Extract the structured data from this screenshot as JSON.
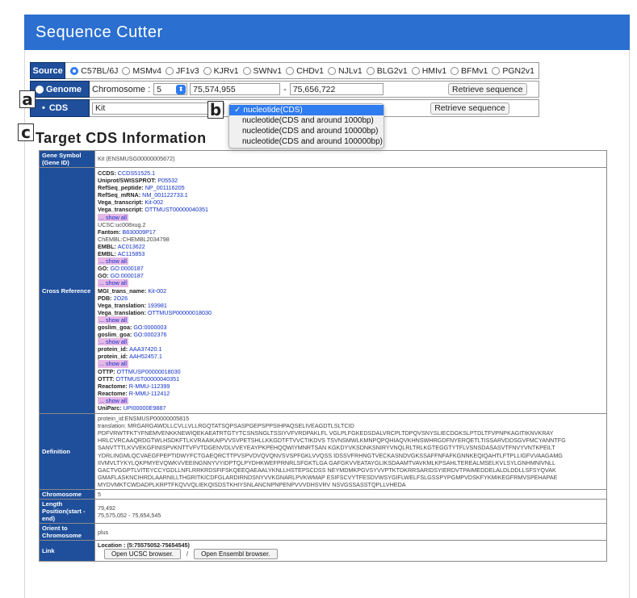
{
  "app": {
    "title": "Sequence Cutter"
  },
  "source": {
    "label": "Source",
    "options": [
      "C57BL/6J",
      "MSMv4",
      "JF1v3",
      "KJRv1",
      "SWNv1",
      "CHDv1",
      "NJLv1",
      "BLG2v1",
      "HMIv1",
      "BFMv1",
      "PGN2v1"
    ],
    "selected": "C57BL/6J"
  },
  "genome": {
    "label": "Genome",
    "chromosome_label": "Chromosome :",
    "chromosome_value": "5",
    "start": "75,574,955",
    "separator": "-",
    "end": "75,656,722",
    "retrieve_label": "Retrieve sequence"
  },
  "cds": {
    "label": "CDS",
    "gene_value": "Kit",
    "retrieve_label": "Retrieve sequence",
    "dropdown_options": [
      "nucleotide(CDS)",
      "nucleotide(CDS and around 1000bp)",
      "nucleotide(CDS and around 10000bp)",
      "nucleotide(CDS and around 100000bp)"
    ],
    "selected_check": "✓"
  },
  "annotations": {
    "a": "a",
    "b": "b",
    "c": "c"
  },
  "section_title": "Target CDS Information",
  "info": {
    "gene_symbol_header": "Gene Symbol (Gene ID)",
    "gene_symbol_value": "Kit (ENSMUSG00000005672)",
    "cross_header": "Cross Reference",
    "cross_ref": [
      {
        "k": "CCDS:",
        "v": "CCDS51525.1"
      },
      {
        "k": "Uniprot/SWISSPROT:",
        "v": "P05532"
      },
      {
        "k": "RefSeq_peptide:",
        "v": "NP_001116205"
      },
      {
        "k": "RefSeq_mRNA:",
        "v": "NM_001122733.1"
      },
      {
        "k": "Vega_transcript:",
        "v": "Kit-002"
      },
      {
        "k": "Vega_transcript:",
        "v": "OTTMUST00000040351"
      },
      {
        "show": "... show all"
      },
      {
        "plain": "UCSC:uc008xug.2"
      },
      {
        "k": "Fantom:",
        "v": "B830009P17"
      },
      {
        "plain": "ChEMBL:CHEMBL2034798"
      },
      {
        "k": "EMBL:",
        "v": "AC013622"
      },
      {
        "k": "EMBL:",
        "v": "AC115853"
      },
      {
        "show": "... show all"
      },
      {
        "k": "GO:",
        "v": "GO:0000187"
      },
      {
        "k": "GO:",
        "v": "GO:0000187"
      },
      {
        "show": "... show all"
      },
      {
        "k": "MGI_trans_name:",
        "v": "Kit-002"
      },
      {
        "k": "PDB:",
        "v": "2O26"
      },
      {
        "k": "Vega_translation:",
        "v": "193981"
      },
      {
        "k": "Vega_translation:",
        "v": "OTTMUSP00000018030"
      },
      {
        "show": "... show all"
      },
      {
        "k": "goslim_goa:",
        "v": "GO:0000003"
      },
      {
        "k": "goslim_goa:",
        "v": "GO:0002376"
      },
      {
        "show": "... show all"
      },
      {
        "k": "protein_id:",
        "v": "AAA37420.1"
      },
      {
        "k": "protein_id:",
        "v": "AAH52457.1"
      },
      {
        "show": "... show all"
      },
      {
        "k": "OTTP:",
        "v": "OTTMUSP00000018030"
      },
      {
        "k": "OTTT:",
        "v": "OTTMUST00000040351"
      },
      {
        "k": "Reactome:",
        "v": "R-MMU-112399"
      },
      {
        "k": "Reactome:",
        "v": "R-MMU-112412"
      },
      {
        "show": "... show all"
      },
      {
        "k": "UniParc:",
        "v": "UPI00000E9887"
      }
    ],
    "definition_header": "Definition",
    "definition_lines": [
      "protein_id:ENSMUSP00000005815",
      "translation: MRGARGAWDLLCVLLVLLRGQTATSQPSASPGEPSPPSIHPAQSELIVEAGDTLSLTCID",
      "PDFVRWTFKTYFNEMVENKKNEWIQEKAEATRTGTYTCSNSNGLTSSIYVFVRDPAKLFL VGLPLFGKEDSDALVRCPLTDPQVSNYSLIECDGKSLPTDLTFVPNPKAGITIKNVKRAY",
      "HRLCVRCAAQRDGTWLHSDKFTLKVRAAIKAIPVVSVPETSHLLKKGDTFTVVCTIKDVS TSVNSMWLKMNPQPQHIAQVKHNSWHRGDFNYERQETLTISSARVDDSGVFMCYANNTFG",
      "SANVTTTLKVVEKGFINISPVKNTTVFVTDGENVDLVVEYEAYPKPEHQQWIYMNRTSAN KGKDYVKSDNKSNIRYVNQLRLTRLKGTEGGTYTFLVSNSDASASVTFNVYVNTKPEILT",
      "YDRLINGMLQCVAEGFPEPTIDWYFCTGAEQRCTTPVSPVDVQVQNVSVSPFGKLVVQSS IDSSVFRHNGTVECKASNDVGKSSAFFNFAFKGNNKEQIQAHTLFTPLLIGFVVAAGAMG",
      "IIVMVLTYKYLQKPMYEVQWKVVEEINGNNYVYIDPTQLPYDHKWEFPRNRLSFGKTLGA GAFGKVVEATAYGLIKSDAAMTVAVKMLKPSAHLTEREALMSELKVLSYLGNHMNIVNLL",
      "GACTVGGPTLVITEYCCYGDLLNFLRRKRDSFIFSKQEEQAEAALYKNLLHSTEPSCDSS NEYMDMKPGVSYVVPTKTDKRRSARIDSYIERDVTPAIMEDDELALDLDDLLSFSYQVAK",
      "GMAFLASKNCIHRDLAARNILLTHGRITKICDFGLARDIRNDSNYVVKGNARLPVKWMAP ESIFSCVYTFESDVWSYGIFLWELFSLGSSPYPGMPVDSKFYKMIKEGFRMVSPEHAPAE",
      "MYDVMKTCWDADPLKRPTFKQVVQLIEKQISDSTKHIYSNLANCNPNPENPVVVDHSVRV NSVGSSASSTQPLLVHEDA"
    ],
    "chromosome_header": "Chromosome",
    "chromosome_value": "5",
    "length_header": "Length Position(start - end)",
    "length_value": "79,492",
    "position_value": "75,575,052 - 75,654,545",
    "orient_header": "Orient to Chromosome",
    "orient_value": "plus",
    "link_header": "Link",
    "location_label": "Location : (5:75575052-75654545)",
    "ucsc_button": "Open UCSC browser.",
    "link_separator": "/",
    "ensembl_button": "Open Ensembl browser."
  }
}
